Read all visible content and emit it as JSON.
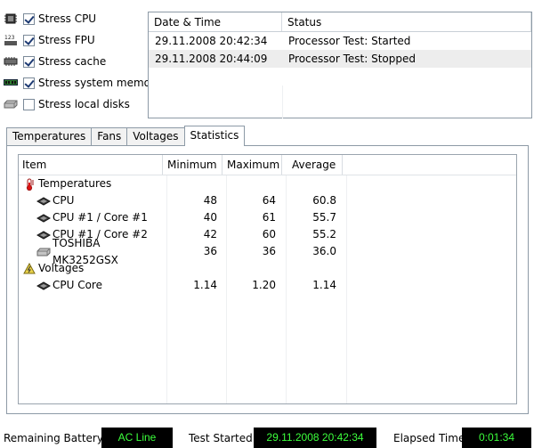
{
  "stress_options": [
    {
      "label": "Stress CPU",
      "checked": true,
      "icon": "cpu-icon"
    },
    {
      "label": "Stress FPU",
      "checked": true,
      "icon": "fpu-icon"
    },
    {
      "label": "Stress cache",
      "checked": true,
      "icon": "cache-icon"
    },
    {
      "label": "Stress system memory",
      "checked": true,
      "icon": "memory-icon"
    },
    {
      "label": "Stress local disks",
      "checked": false,
      "icon": "disk-icon"
    }
  ],
  "log": {
    "columns": [
      "Date & Time",
      "Status"
    ],
    "rows": [
      {
        "datetime": "29.11.2008 20:42:34",
        "status": "Processor Test: Started"
      },
      {
        "datetime": "29.11.2008 20:44:09",
        "status": "Processor Test: Stopped"
      }
    ]
  },
  "tabs": [
    {
      "label": "Temperatures",
      "active": false
    },
    {
      "label": "Fans",
      "active": false
    },
    {
      "label": "Voltages",
      "active": false
    },
    {
      "label": "Statistics",
      "active": true
    }
  ],
  "statistics": {
    "columns": {
      "item": "Item",
      "minimum": "Minimum",
      "maximum": "Maximum",
      "average": "Average"
    },
    "groups": [
      {
        "name": "Temperatures",
        "icon": "thermometer-icon",
        "rows": [
          {
            "item": "CPU",
            "minimum": "48",
            "maximum": "64",
            "average": "60.8",
            "icon": "cpu-icon"
          },
          {
            "item": "CPU #1 / Core #1",
            "minimum": "40",
            "maximum": "61",
            "average": "55.7",
            "icon": "cpu-icon"
          },
          {
            "item": "CPU #1 / Core #2",
            "minimum": "42",
            "maximum": "60",
            "average": "55.2",
            "icon": "cpu-icon"
          },
          {
            "item": "TOSHIBA MK3252GSX",
            "minimum": "36",
            "maximum": "36",
            "average": "36.0",
            "icon": "disk-icon"
          }
        ]
      },
      {
        "name": "Voltages",
        "icon": "voltage-icon",
        "rows": [
          {
            "item": "CPU Core",
            "minimum": "1.14",
            "maximum": "1.20",
            "average": "1.14",
            "icon": "cpu-icon"
          }
        ]
      }
    ]
  },
  "status_bar": {
    "remaining_battery_label": "Remaining Battery:",
    "remaining_battery_value": "AC Line",
    "test_started_label": "Test Started:",
    "test_started_value": "29.11.2008 20:42:34",
    "elapsed_time_label": "Elapsed Time:",
    "elapsed_time_value": "0:01:34"
  },
  "colors": {
    "status_value_text": "#3cff3c",
    "status_value_bg": "#000000"
  }
}
